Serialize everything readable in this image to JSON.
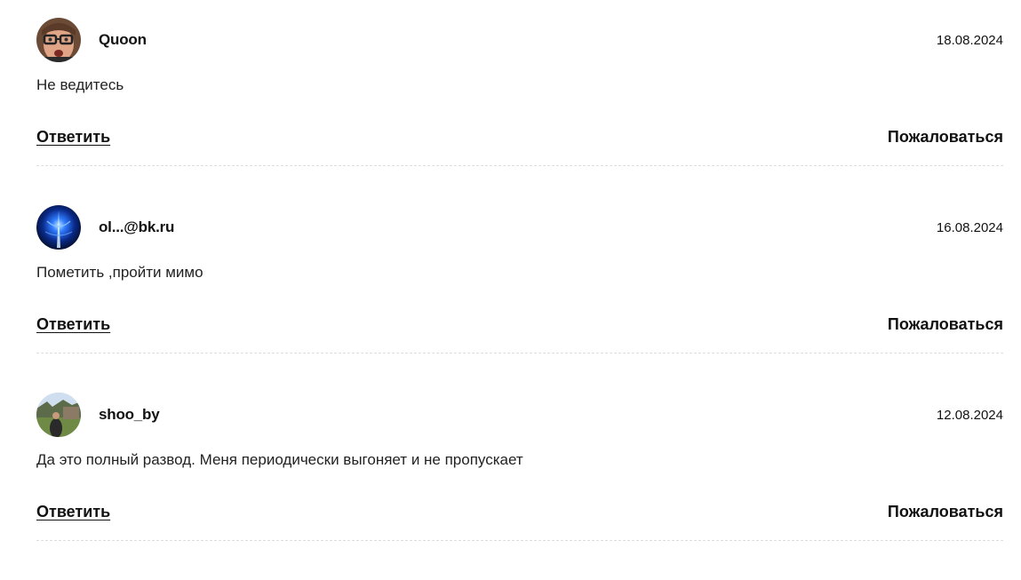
{
  "comments": [
    {
      "author": "Quoon",
      "date": "18.08.2024",
      "text": "Не ведитесь",
      "reply_label": "Ответить",
      "report_label": "Пожаловаться"
    },
    {
      "author": "ol...@bk.ru",
      "date": "16.08.2024",
      "text": "Пометить ,пройти мимо",
      "reply_label": "Ответить",
      "report_label": "Пожаловаться"
    },
    {
      "author": "shoo_by",
      "date": "12.08.2024",
      "text": "Да это полный развод. Меня периодически выгоняет и не пропускает",
      "reply_label": "Ответить",
      "report_label": "Пожаловаться"
    }
  ]
}
